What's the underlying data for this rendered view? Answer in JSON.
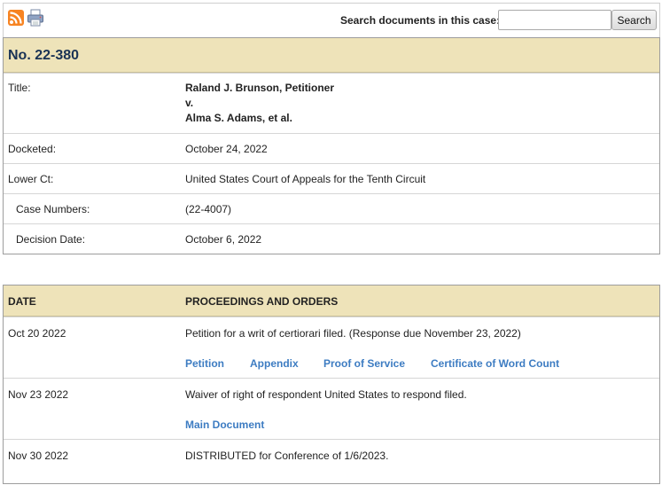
{
  "toolbar": {
    "rss_icon": "rss-feed-icon",
    "print_icon": "printer-icon",
    "search_label": "Search documents in this case:",
    "search_value": "",
    "search_button": "Search"
  },
  "case": {
    "number": "No. 22-380",
    "title_label": "Title:",
    "title_lines": [
      "Raland J. Brunson, Petitioner",
      "v.",
      "Alma S. Adams, et al."
    ],
    "docketed_label": "Docketed:",
    "docketed": "October 24, 2022",
    "lower_ct_label": "Lower Ct:",
    "lower_ct": "United States Court of Appeals for the Tenth Circuit",
    "case_numbers_label": "Case Numbers:",
    "case_numbers": "(22-4007)",
    "decision_date_label": "Decision Date:",
    "decision_date": "October 6, 2022"
  },
  "docket": {
    "col_date": "DATE",
    "col_proceedings": "PROCEEDINGS AND ORDERS",
    "entries": [
      {
        "date": "Oct 20 2022",
        "text": "Petition for a writ of certiorari filed. (Response due November 23, 2022)",
        "links": [
          "Petition",
          "Appendix",
          "Proof of Service",
          "Certificate of Word Count"
        ]
      },
      {
        "date": "Nov 23 2022",
        "text": "Waiver of right of respondent United States to respond filed.",
        "links": [
          "Main Document"
        ]
      },
      {
        "date": "Nov 30 2022",
        "text": "DISTRIBUTED for Conference of 1/6/2023.",
        "links": []
      }
    ]
  },
  "colors": {
    "header_bg": "#eee3b9",
    "link": "#3d7cc2",
    "case_number": "#1a3355",
    "rss": "#f78422"
  }
}
